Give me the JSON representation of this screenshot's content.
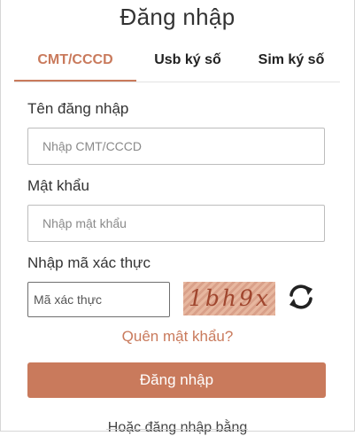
{
  "header": {
    "title": "Đăng nhập"
  },
  "tabs": [
    {
      "label": "CMT/CCCD",
      "active": true
    },
    {
      "label": "Usb ký số",
      "active": false
    },
    {
      "label": "Sim ký số",
      "active": false
    }
  ],
  "form": {
    "username_label": "Tên đăng nhập",
    "username_placeholder": "Nhập CMT/CCCD",
    "password_label": "Mật khẩu",
    "password_placeholder": "Nhập mật khẩu",
    "captcha_label": "Nhập mã xác thực",
    "captcha_placeholder": "Mã xác thực",
    "captcha_text": "1bh9x",
    "refresh_icon": "refresh-icon",
    "forgot_password": "Quên mật khẩu?",
    "login_button": "Đăng nhập",
    "alt_login_text": "Hoặc đăng nhập bằng"
  },
  "colors": {
    "accent": "#c97a5c",
    "text": "#333333",
    "border": "#bdbdbd"
  }
}
